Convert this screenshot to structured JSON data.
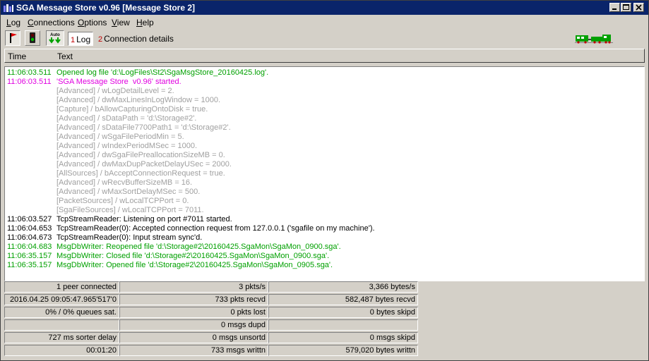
{
  "window": {
    "title": "SGA Message Store  v0.96  [Message Store 2]"
  },
  "menu": [
    "Log",
    "Connections",
    "Options",
    "View",
    "Help"
  ],
  "menu_underline": [
    "L",
    "C",
    "O",
    "V",
    "H"
  ],
  "menu_rest": [
    "og",
    "onnections",
    "ptions",
    "iew",
    "elp"
  ],
  "toolbar": {
    "auto_label": "Auto",
    "tabs": [
      {
        "num": "1",
        "label": "Log"
      },
      {
        "num": "2",
        "label": "Connection details"
      }
    ]
  },
  "columns": {
    "time": "Time",
    "text": "Text"
  },
  "colors": {
    "green": "#00a000",
    "magenta": "#e000e0",
    "grey": "#a0a0a0",
    "black": "#000000",
    "title_bar": "#0a246a"
  },
  "log": [
    {
      "time": "11:06:03.511",
      "text": "Opened log file 'd:\\LogFiles\\St2\\SgaMsgStore_20160425.log'.",
      "color": "#00a000"
    },
    {
      "time": "11:06:03.511",
      "text": "'SGA Message Store  v0.96' started.",
      "color": "#e000e0"
    },
    {
      "time": "",
      "text": "[Advanced] / wLogDetailLevel = 2.",
      "color": "#a0a0a0"
    },
    {
      "time": "",
      "text": "[Advanced] / dwMaxLinesInLogWindow = 1000.",
      "color": "#a0a0a0"
    },
    {
      "time": "",
      "text": "[Capture] / bAllowCapturingOntoDisk = true.",
      "color": "#a0a0a0"
    },
    {
      "time": "",
      "text": "[Advanced] / sDataPath = 'd:\\Storage#2'.",
      "color": "#a0a0a0"
    },
    {
      "time": "",
      "text": "[Advanced] / sDataFile7700Path1 = 'd:\\Storage#2'.",
      "color": "#a0a0a0"
    },
    {
      "time": "",
      "text": "[Advanced] / wSgaFilePeriodMin = 5.",
      "color": "#a0a0a0"
    },
    {
      "time": "",
      "text": "[Advanced] / wIndexPeriodMSec = 1000.",
      "color": "#a0a0a0"
    },
    {
      "time": "",
      "text": "[Advanced] / dwSgaFilePreallocationSizeMB = 0.",
      "color": "#a0a0a0"
    },
    {
      "time": "",
      "text": "[Advanced] / dwMaxDupPacketDelayUSec = 2000.",
      "color": "#a0a0a0"
    },
    {
      "time": "",
      "text": "[AllSources] / bAcceptConnectionRequest = true.",
      "color": "#a0a0a0"
    },
    {
      "time": "",
      "text": "[Advanced] / wRecvBufferSizeMB = 16.",
      "color": "#a0a0a0"
    },
    {
      "time": "",
      "text": "[Advanced] / wMaxSortDelayMSec = 500.",
      "color": "#a0a0a0"
    },
    {
      "time": "",
      "text": "[PacketSources] / wLocalTCPPort = 0.",
      "color": "#a0a0a0"
    },
    {
      "time": "",
      "text": "[SgaFileSources] / wLocalTCPPort = 7011.",
      "color": "#a0a0a0"
    },
    {
      "time": "11:06:03.527",
      "text": "TcpStreamReader: Listening on port #7011 started.",
      "color": "#000000"
    },
    {
      "time": "11:06:04.653",
      "text": "TcpStreamReader(0): Accepted connection request from 127.0.0.1 ('sgafile on my machine').",
      "color": "#000000"
    },
    {
      "time": "11:06:04.673",
      "text": "TcpStreamReader(0): Input stream sync'd.",
      "color": "#000000"
    },
    {
      "time": "11:06:04.683",
      "text": "MsgDbWriter: Reopened file 'd:\\Storage#2\\20160425.SgaMon\\SgaMon_0900.sga'.",
      "color": "#00a000"
    },
    {
      "time": "11:06:35.157",
      "text": "MsgDbWriter: Closed file 'd:\\Storage#2\\20160425.SgaMon\\SgaMon_0900.sga'.",
      "color": "#00a000"
    },
    {
      "time": "11:06:35.157",
      "text": "MsgDbWriter: Opened file 'd:\\Storage#2\\20160425.SgaMon\\SgaMon_0905.sga'.",
      "color": "#00a000"
    }
  ],
  "status": [
    [
      "1 peer connected",
      "3 pkts/s",
      "3,366 bytes/s"
    ],
    [
      "2016.04.25 09:05:47.965'517'0",
      "733 pkts recvd",
      "582,487 bytes recvd"
    ],
    [
      "0% / 0% queues sat.",
      "0 pkts lost",
      "0 bytes skipd"
    ],
    [
      "",
      "0 msgs dupd",
      ""
    ],
    [
      "727 ms sorter delay",
      "0 msgs unsortd",
      "0 msgs skipd"
    ],
    [
      "00:01:20",
      "733 msgs writtn",
      "579,020 bytes writtn"
    ]
  ]
}
